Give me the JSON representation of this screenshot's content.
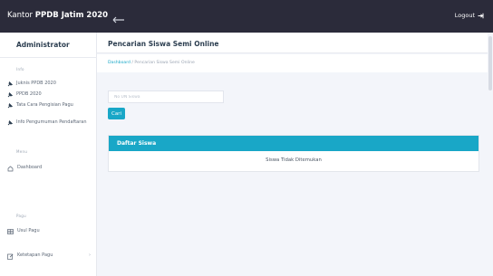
{
  "topbar": {
    "brand_prefix": "Kantor ",
    "brand_bold": "PPDB Jatim 2020",
    "logout_label": "Logout"
  },
  "sidebar": {
    "title": "Administrator",
    "section_labels": [
      "Info",
      "Menu",
      "Pagu"
    ],
    "items": [
      {
        "label": "Juknis PPDB 2020",
        "icon": "pin-icon"
      },
      {
        "label": "PPDB 2020",
        "icon": "pin-icon"
      },
      {
        "label": "Tata Cara Pengisian Pagu",
        "icon": "pin-icon"
      },
      {
        "label": "Info Pengumuman Pendaftaran",
        "icon": "pin-icon"
      },
      {
        "label": "Dashboard",
        "icon": "home-icon"
      },
      {
        "label": "Usul Pagu",
        "icon": "table-icon"
      },
      {
        "label": "Ketetapan Pagu",
        "icon": "edit-icon"
      }
    ]
  },
  "page": {
    "title": "Pencarian Siswa Semi Online",
    "breadcrumb_home": "Dashboard",
    "breadcrumb_sep": " / ",
    "breadcrumb_current": "Pencarian Siswa Semi Online"
  },
  "search": {
    "placeholder": "No UN Siswa",
    "button_label": "Cari"
  },
  "student_list": {
    "title": "Daftar Siswa",
    "empty_message": "Siswa Tidak Ditemukan"
  },
  "colors": {
    "topbar": "#2b2b3a",
    "accent": "#19a7c7",
    "page_bg": "#f3f5fa"
  }
}
